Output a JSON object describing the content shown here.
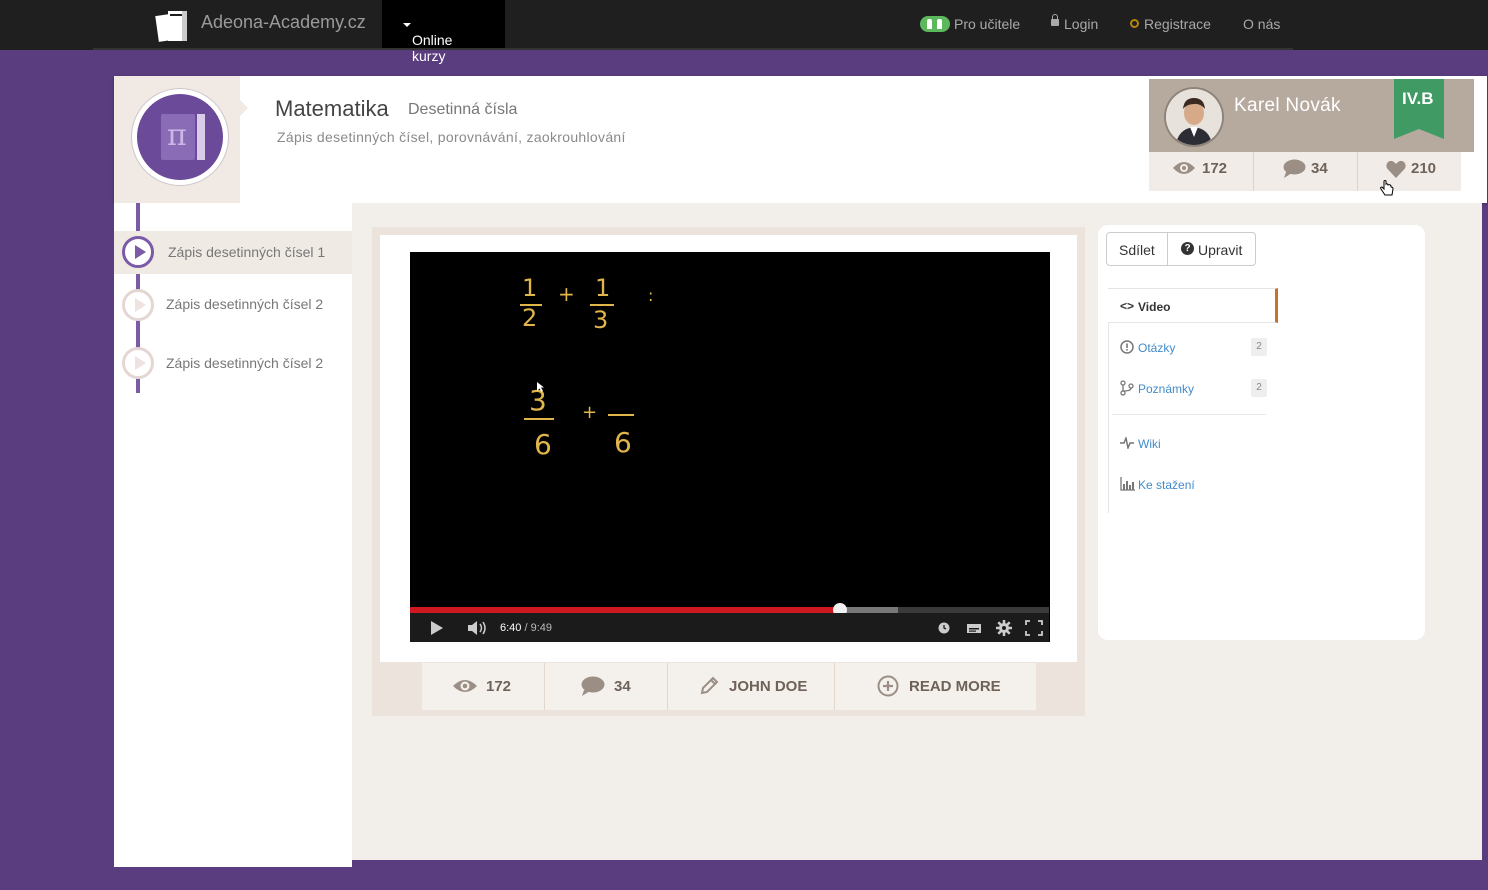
{
  "nav": {
    "brand": "Adeona-Academy.cz",
    "online_kurzy": "Online kurzy",
    "pro_ucitele": "Pro učitele",
    "login": "Login",
    "registrace": "Registrace",
    "o_nas": "O nás"
  },
  "course": {
    "title": "Matematika",
    "subtitle": "Desetinná čísla",
    "description": "Zápis desetinných čísel, porovnávání, zaokrouhlování"
  },
  "profile": {
    "name": "Karel Novák",
    "class_badge": "IV.B",
    "views": "172",
    "comments": "34",
    "likes": "210"
  },
  "lessons": [
    {
      "label": "Zápis desetinných čísel 1",
      "active": true
    },
    {
      "label": "Zápis desetinných čísel 2",
      "active": false
    },
    {
      "label": "Zápis desetinných čísel 2",
      "active": false
    }
  ],
  "video": {
    "current_time": "6:40",
    "duration": "/ 9:49",
    "played_fraction": 0.673,
    "buffered_fraction": 0.764,
    "board": {
      "eq1_a_num": "1",
      "eq1_a_den": "2",
      "eq1_plus": "+",
      "eq1_b_num": "1",
      "eq1_b_den": "3",
      "eq1_colon": ":",
      "eq2_a_num": "3",
      "eq2_a_den": "6",
      "eq2_plus": "+",
      "eq2_b_den": "6"
    }
  },
  "video_stats": {
    "views": "172",
    "comments": "34",
    "author": "JOHN DOE",
    "read_more": "READ MORE"
  },
  "actions": {
    "share": "Sdílet",
    "edit": "Upravit"
  },
  "tabs": [
    {
      "label": "Video",
      "icon": "code-icon",
      "badge": ""
    },
    {
      "label": "Otázky",
      "icon": "exclamation-circle-icon",
      "badge": "2"
    },
    {
      "label": "Poznámky",
      "icon": "branch-icon",
      "badge": "2"
    },
    {
      "label": "Wiki",
      "icon": "pulse-icon",
      "badge": ""
    },
    {
      "label": "Ke stažení",
      "icon": "bar-chart-icon",
      "badge": ""
    }
  ],
  "colors": {
    "page_bg": "#5a3d7e",
    "accent_purple": "#7b5aa6",
    "progress_red": "#cc181e",
    "badge_green": "#3f9a63",
    "tab_active_border": "#c7712b"
  }
}
